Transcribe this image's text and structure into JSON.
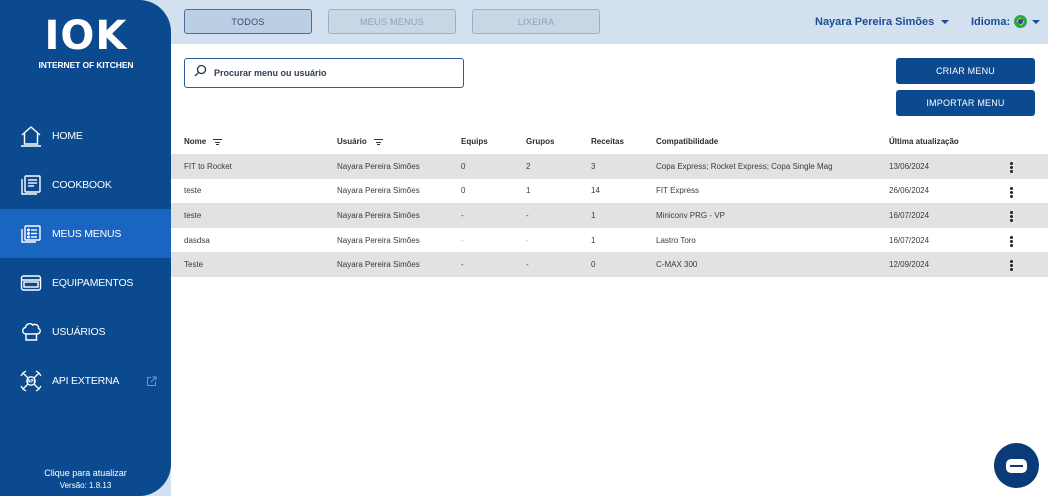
{
  "brand": {
    "logo_text": "IOK",
    "logo_subtitle": "INTERNET OF KITCHEN"
  },
  "sidebar": {
    "items": [
      {
        "label": "HOME",
        "icon": "home-icon",
        "active": false
      },
      {
        "label": "COOKBOOK",
        "icon": "cookbook-icon",
        "active": false
      },
      {
        "label": "MEUS MENUS",
        "icon": "menus-icon",
        "active": true
      },
      {
        "label": "EQUIPAMENTOS",
        "icon": "equipment-icon",
        "active": false
      },
      {
        "label": "USUÁRIOS",
        "icon": "chef-hat-icon",
        "active": false
      },
      {
        "label": "API EXTERNA",
        "icon": "api-icon",
        "active": false,
        "external": true
      }
    ],
    "footer_refresh": "Clique para atualizar",
    "footer_version": "Versão: 1.8.13"
  },
  "tabs": [
    {
      "label": "TODOS",
      "active": true
    },
    {
      "label": "MEUS MENUS",
      "active": false
    },
    {
      "label": "LIXEIRA",
      "active": false
    }
  ],
  "header": {
    "user_name": "Nayara Pereira Simões",
    "language_label": "Idioma:",
    "language_flag": "brazil-flag-icon"
  },
  "search": {
    "placeholder": "Procurar menu ou usuário",
    "value": ""
  },
  "actions": {
    "create_label": "CRIAR MENU",
    "import_label": "IMPORTAR MENU"
  },
  "table": {
    "headers": [
      "Nome",
      "Usuário",
      "Equips",
      "Grupos",
      "Receitas",
      "Compatibilidade",
      "Última atualização"
    ],
    "rows": [
      [
        "FIT to Rocket",
        "Nayara Pereira Simões",
        "0",
        "2",
        "3",
        "Copa Express; Rocket Express; Copa Single Mag",
        "13/06/2024"
      ],
      [
        "teste",
        "Nayara Pereira Simões",
        "0",
        "1",
        "14",
        "FIT Express",
        "26/06/2024"
      ],
      [
        "teste",
        "Nayara Pereira Simões",
        "-",
        "-",
        "1",
        "Miniconv PRG - VP",
        "16/07/2024"
      ],
      [
        "dasdsa",
        "Nayara Pereira Simões",
        "-",
        "-",
        "1",
        "Lastro Toro",
        "16/07/2024"
      ],
      [
        "Teste",
        "Nayara Pereira Simões",
        "-",
        "-",
        "0",
        "C-MAX 300",
        "12/09/2024"
      ]
    ]
  },
  "colors": {
    "sidebar": "#0b4a8f",
    "active_nav": "#1b65c2",
    "topbar": "#d3e0ef",
    "accent": "#1a4f91"
  }
}
